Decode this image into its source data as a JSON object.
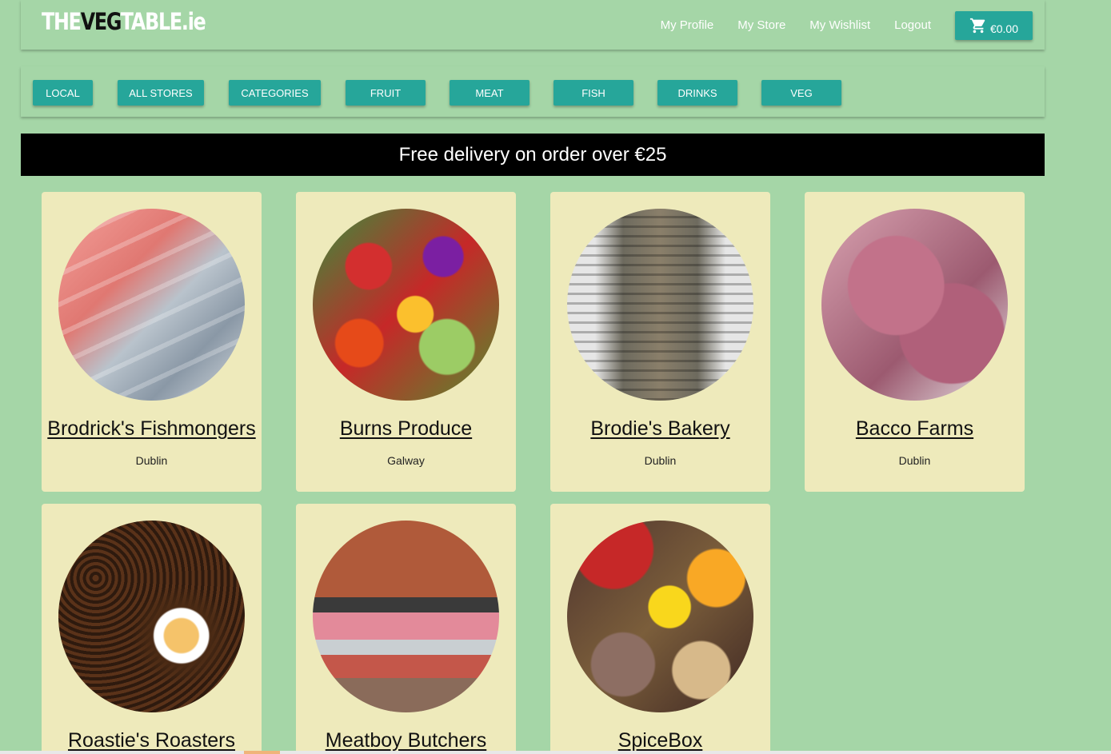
{
  "brand": {
    "part1": "THE",
    "part2": "VEG",
    "part3": "TABLE.ie"
  },
  "nav": {
    "links": [
      "My Profile",
      "My Store",
      "My Wishlist",
      "Logout"
    ],
    "cart_amount": "€0.00",
    "cart_icon": "shopping-cart-icon"
  },
  "categories": [
    "LOCAL",
    "ALL STORES",
    "CATEGORIES",
    "FRUIT",
    "MEAT",
    "FISH",
    "DRINKS",
    "VEG"
  ],
  "banner": {
    "text": "Free delivery on order over €25"
  },
  "stores": [
    {
      "name": "Brodrick's Fishmongers",
      "location": "Dublin"
    },
    {
      "name": "Burns Produce",
      "location": "Galway"
    },
    {
      "name": "Brodie's Bakery",
      "location": "Dublin"
    },
    {
      "name": "Bacco Farms",
      "location": "Dublin"
    },
    {
      "name": "Roastie's Roasters",
      "location": ""
    },
    {
      "name": "Meatboy Butchers",
      "location": ""
    },
    {
      "name": "SpiceBox",
      "location": ""
    }
  ],
  "colors": {
    "background": "#a5d6a7",
    "button": "#26a69a",
    "card": "#eeeabb",
    "banner": "#000000"
  }
}
